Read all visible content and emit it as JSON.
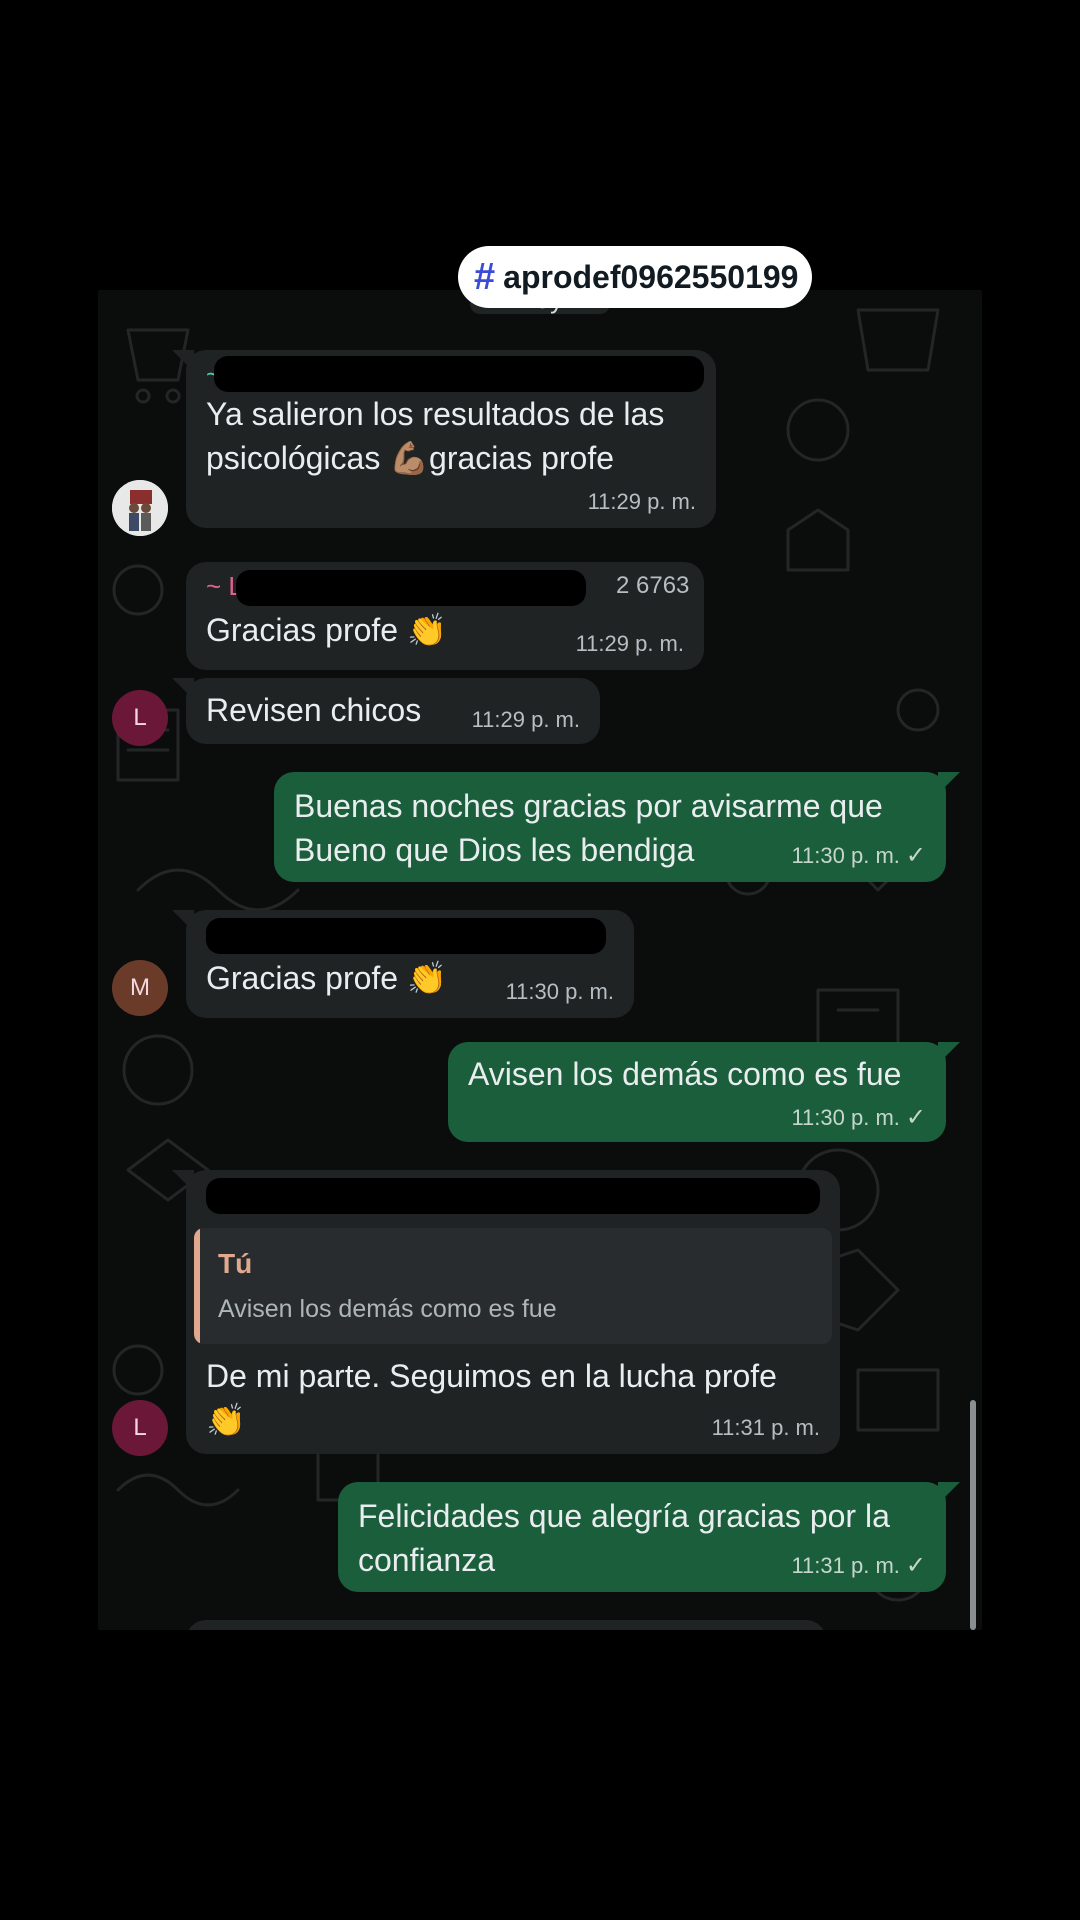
{
  "hashtag": "aprodef0962550199",
  "date_chip": "Hoy",
  "avatars": {
    "l": "L",
    "m": "M"
  },
  "messages": [
    {
      "id": "m1",
      "direction": "in",
      "sender_partial": "~",
      "text": "Ya salieron los resultados de las\npsicológicas 💪🏽gracias profe",
      "time": "11:29 p. m."
    },
    {
      "id": "m2",
      "direction": "in",
      "sender_partial": "~ L",
      "sender_tail": "2 6763",
      "text": "Gracias profe 👏",
      "time": "11:29 p. m."
    },
    {
      "id": "m3",
      "direction": "in",
      "text": "Revisen chicos",
      "time": "11:29 p. m."
    },
    {
      "id": "m4",
      "direction": "out",
      "text": "Buenas noches gracias por avisarme que\nBueno que Dios les bendiga",
      "time": "11:30 p. m.",
      "status": "✓"
    },
    {
      "id": "m5",
      "direction": "in",
      "text": "Gracias profe 👏",
      "time": "11:30 p. m."
    },
    {
      "id": "m6",
      "direction": "out",
      "text": "Avisen los demás como es fue",
      "time": "11:30 p. m.",
      "status": "✓"
    },
    {
      "id": "m7",
      "direction": "in",
      "reply_to": {
        "name": "Tú",
        "text": "Avisen los demás como es fue"
      },
      "text": "De mi parte. Seguimos en la lucha profe\n👏",
      "time": "11:31 p. m."
    },
    {
      "id": "m8",
      "direction": "out",
      "text": "Felicidades que alegría gracias por la\nconfianza",
      "time": "11:31 p. m.",
      "status": "✓"
    }
  ],
  "colors": {
    "incoming_bubble": "#1f2324",
    "outgoing_bubble": "#1b5e3b",
    "background": "#0b0c0c",
    "quote_accent": "#e0a98f",
    "avatar_l": "#6b1838",
    "avatar_m": "#6b3b2a"
  }
}
